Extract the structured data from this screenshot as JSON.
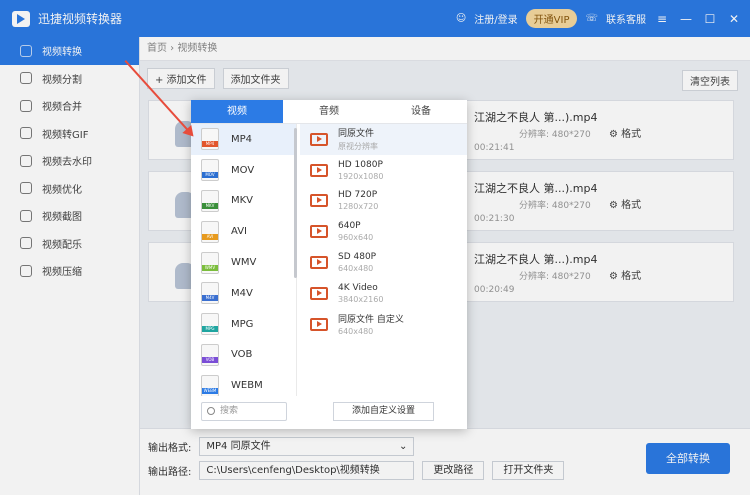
{
  "app": {
    "title": "迅捷视频转换器"
  },
  "header": {
    "login": "注册/登录",
    "vip": "开通VIP",
    "support": "联系客服"
  },
  "sidebar": {
    "items": [
      {
        "label": "视频转换",
        "active": true,
        "icon": "convert-icon"
      },
      {
        "label": "视频分割",
        "icon": "split-icon"
      },
      {
        "label": "视频合并",
        "icon": "merge-icon"
      },
      {
        "label": "视频转GIF",
        "icon": "gif-icon"
      },
      {
        "label": "视频去水印",
        "icon": "watermark-icon"
      },
      {
        "label": "视频优化",
        "icon": "optimize-icon"
      },
      {
        "label": "视频截图",
        "icon": "screenshot-icon"
      },
      {
        "label": "视频配乐",
        "icon": "music-icon"
      },
      {
        "label": "视频压缩",
        "icon": "compress-icon"
      }
    ]
  },
  "breadcrumb": {
    "home": "首页",
    "current": "视频转换"
  },
  "toolbar": {
    "add_file": "+ 添加文件",
    "add_folder": "添加文件夹",
    "clear": "清空列表"
  },
  "tasks": [
    {
      "name": "江湖之不良人 第...).mp4",
      "res": "分辨率: 480*270",
      "dur": "00:21:41",
      "fmt": "格式"
    },
    {
      "name": "江湖之不良人 第...).mp4",
      "res": "分辨率: 480*270",
      "dur": "00:21:30",
      "fmt": "格式"
    },
    {
      "name": "江湖之不良人 第...).mp4",
      "res": "分辨率: 480*270",
      "dur": "00:20:49",
      "fmt": "格式"
    }
  ],
  "output": {
    "format_label": "输出格式:",
    "format_value": "MP4  同原文件",
    "path_label": "输出路径:",
    "path_value": "C:\\Users\\cenfeng\\Desktop\\视频转换",
    "change_path": "更改路径",
    "open_folder": "打开文件夹",
    "convert_all": "全部转换"
  },
  "format_panel": {
    "tabs": [
      "视频",
      "音频",
      "设备"
    ],
    "formats": [
      {
        "label": "MP4",
        "color": "#e2552b"
      },
      {
        "label": "MOV",
        "color": "#2c6fd1"
      },
      {
        "label": "MKV",
        "color": "#3a8f3a"
      },
      {
        "label": "AVI",
        "color": "#e79a1e"
      },
      {
        "label": "WMV",
        "color": "#7bbd3c"
      },
      {
        "label": "M4V",
        "color": "#3a6fd0"
      },
      {
        "label": "MPG",
        "color": "#1fa5a0"
      },
      {
        "label": "VOB",
        "color": "#7a4dd6"
      },
      {
        "label": "WEBM",
        "color": "#2c7be5"
      }
    ],
    "qualities": [
      {
        "t1": "同原文件",
        "t2": "原视分辨率"
      },
      {
        "t1": "HD 1080P",
        "t2": "1920x1080"
      },
      {
        "t1": "HD 720P",
        "t2": "1280x720"
      },
      {
        "t1": "640P",
        "t2": "960x640"
      },
      {
        "t1": "SD 480P",
        "t2": "640x480"
      },
      {
        "t1": "4K Video",
        "t2": "3840x2160"
      },
      {
        "t1": "同原文件 自定义",
        "t2": "640x480"
      }
    ],
    "search_placeholder": "搜索",
    "add_custom": "添加自定义设置"
  }
}
